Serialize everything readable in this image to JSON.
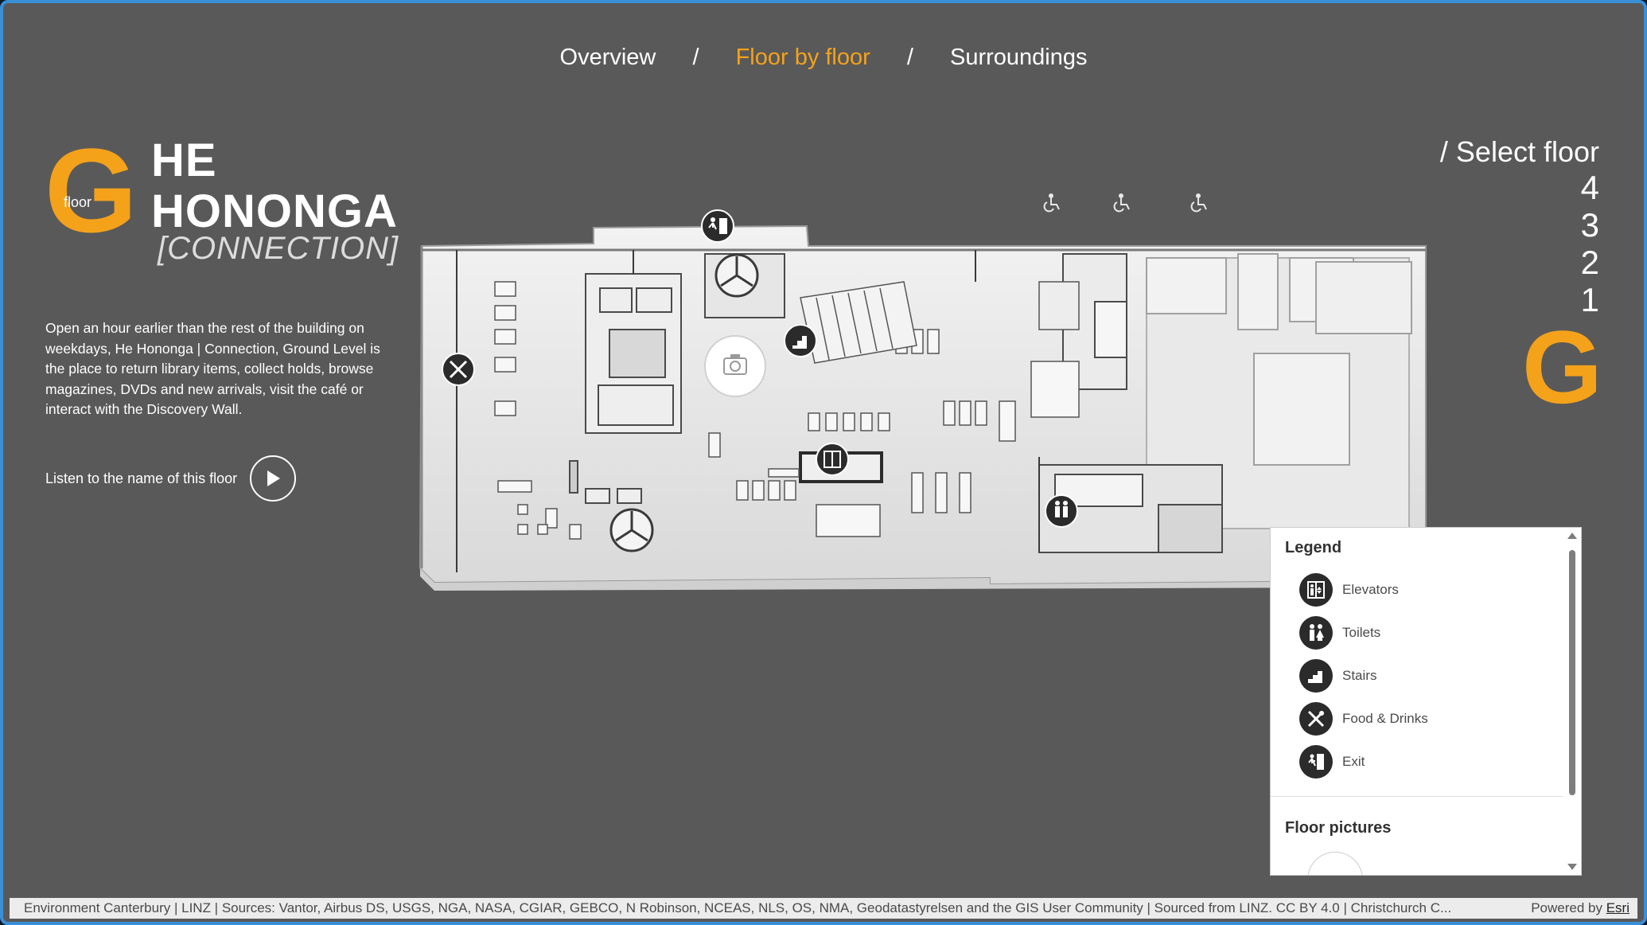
{
  "nav": {
    "items": [
      "Overview",
      "Floor by floor",
      "Surroundings"
    ],
    "separator": "/",
    "active_index": 1
  },
  "floor": {
    "letter": "G",
    "word": "floor",
    "title_line1": "HE",
    "title_line2": "HONONGA",
    "title_line3": "[CONNECTION]",
    "description": "Open an hour earlier than the rest of the building on weekdays, He Hononga | Connection, Ground Level is the place to return library items, collect holds, browse magazines, DVDs and new arrivals, visit the café or interact with the Discovery Wall.",
    "listen_label": "Listen to the name of this floor"
  },
  "select_floor": {
    "title": "/ Select floor",
    "floors": [
      "4",
      "3",
      "2",
      "1"
    ],
    "active": "G"
  },
  "legend": {
    "title": "Legend",
    "items": [
      {
        "label": "Elevators",
        "icon": "elevator-icon"
      },
      {
        "label": "Toilets",
        "icon": "toilets-icon"
      },
      {
        "label": "Stairs",
        "icon": "stairs-icon"
      },
      {
        "label": "Food & Drinks",
        "icon": "food-drinks-icon"
      },
      {
        "label": "Exit",
        "icon": "exit-icon"
      }
    ],
    "pictures_title": "Floor pictures"
  },
  "footer": {
    "attribution": "Environment Canterbury | LINZ | Sources: Vantor, Airbus DS, USGS, NGA, NASA, CGIAR, GEBCO, N Robinson, NCEAS, NLS, OS, NMA, Geodatastyrelsen and the GIS User Community | Sourced from LINZ. CC BY 4.0 | Christchurch C...",
    "powered_prefix": "Powered by",
    "powered_link": "Esri"
  },
  "colors": {
    "accent": "#f5a21b",
    "background": "#595959",
    "text": "#ffffff"
  }
}
